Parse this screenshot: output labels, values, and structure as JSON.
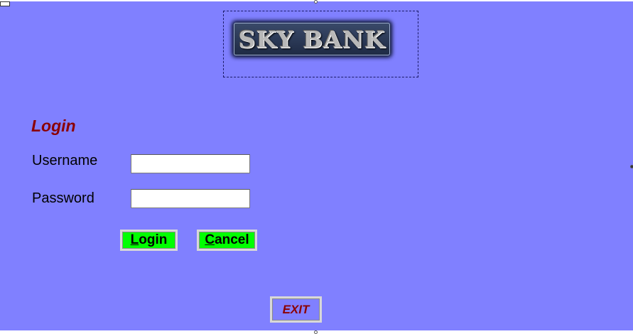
{
  "logo": {
    "text": "SKY BANK"
  },
  "login_form": {
    "heading": "Login",
    "username_label": "Username",
    "username_value": "",
    "password_label": "Password",
    "password_value": "",
    "login_button": {
      "mnemonic": "L",
      "rest": "ogin"
    },
    "cancel_button": {
      "mnemonic": "C",
      "rest": "ancel"
    },
    "exit_button": "EXIT"
  },
  "colors": {
    "background": "#8080ff",
    "heading": "#8b0000",
    "button_fill": "#00ff00",
    "exit_text": "#8b0000"
  }
}
